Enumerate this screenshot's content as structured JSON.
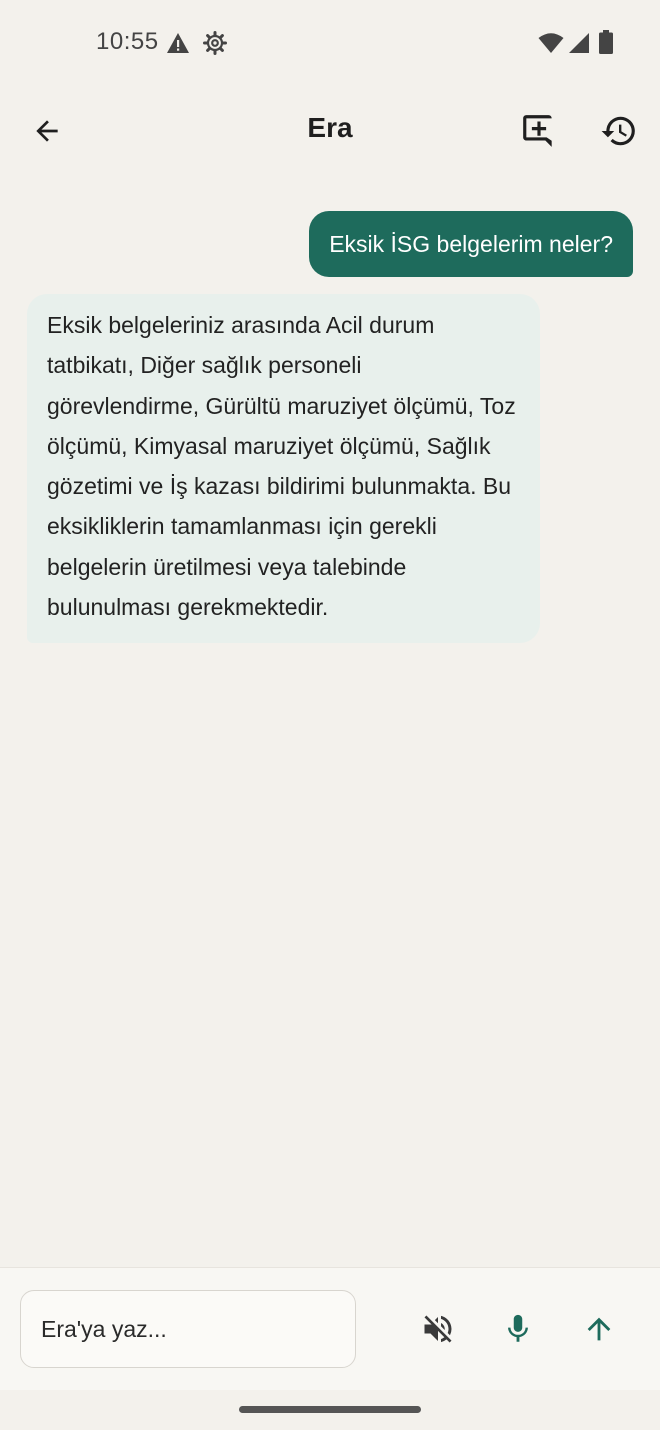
{
  "status_bar": {
    "time": "10:55",
    "icons": [
      "warning-icon",
      "gear-icon",
      "wifi-icon",
      "cell-signal-icon",
      "battery-icon"
    ]
  },
  "app_bar": {
    "title": "Era",
    "icons": [
      "arrow-left-icon",
      "new-chat-icon",
      "history-icon"
    ]
  },
  "messages": [
    {
      "role": "user",
      "text": "Eksik İSG belgelerim neler?"
    },
    {
      "role": "assistant",
      "text": "Eksik belgeleriniz arasında Acil durum tatbikatı, Diğer sağlık personeli görevlendirme, Gürültü maruziyet ölçümü, Toz ölçümü, Kimyasal maruziyet ölçümü, Sağlık gözetimi ve İş kazası bildirimi bulunmakta. Bu eksikliklerin tamamlanması için gerekli belgelerin üretilmesi veya talebinde bulunulması gerekmektedir."
    }
  ],
  "composer": {
    "placeholder": "Era'ya yaz...",
    "icons": [
      "volume-off-icon",
      "microphone-icon",
      "arrow-up-icon"
    ]
  },
  "colors": {
    "accent": "#1e6b5c",
    "background": "#f3f1ec",
    "assistant_bubble": "#e8f0ec"
  }
}
